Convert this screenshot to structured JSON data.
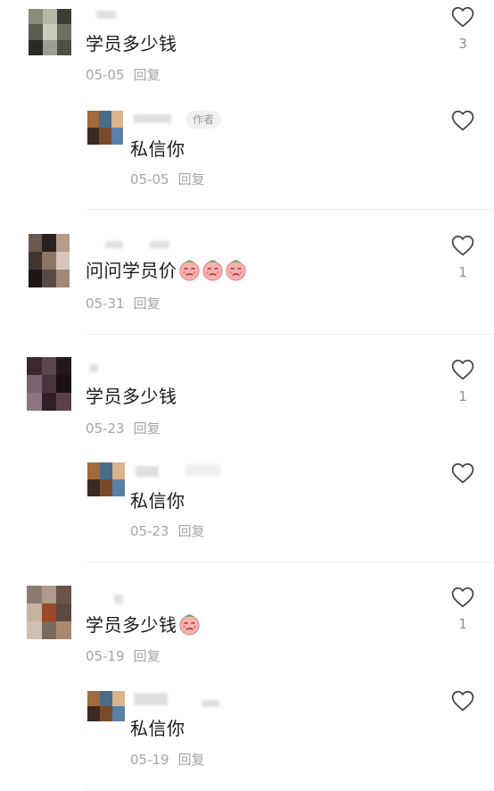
{
  "comments": [
    {
      "text": "学员多少钱",
      "date": "05-05",
      "reply_label": "回复",
      "likes": "3",
      "avatar_colors": [
        "#8a8a7a",
        "#b7b7a6",
        "#3c3c34",
        "#5b5b52",
        "#c9c9bd",
        "#6e6e60",
        "#2a2a25",
        "#9c9c90",
        "#4e4e46"
      ],
      "reply": {
        "text": "私信你",
        "date": "05-05",
        "reply_label": "回复",
        "author_tag": "作者",
        "avatar_colors": [
          "#a06b3c",
          "#4a6b8a",
          "#d9b48c",
          "#3a2a22",
          "#7a4b2a",
          "#5c7fa8"
        ]
      }
    },
    {
      "text": "问问学员价",
      "emoji_count": 3,
      "date": "05-31",
      "reply_label": "回复",
      "likes": "1",
      "avatar_colors": [
        "#6b5a50",
        "#2a2220",
        "#b79c8e",
        "#413530",
        "#8e7566",
        "#d8c6bb",
        "#1c1614",
        "#5a4a42",
        "#a08878"
      ]
    },
    {
      "text": "学员多少钱",
      "date": "05-23",
      "reply_label": "回复",
      "likes": "1",
      "avatar_colors": [
        "#3a2a30",
        "#5c4450",
        "#24181d",
        "#7a6070",
        "#4a3440",
        "#1c1216",
        "#8e7482",
        "#2e2026",
        "#5a4048"
      ],
      "reply": {
        "text": "私信你",
        "date": "05-23",
        "reply_label": "回复",
        "author_tag": "",
        "avatar_colors": [
          "#a06b3c",
          "#4a6b8a",
          "#d9b48c",
          "#3a2a22",
          "#7a4b2a",
          "#5c7fa8"
        ]
      }
    },
    {
      "text": "学员多少钱",
      "emoji_count": 1,
      "date": "05-19",
      "reply_label": "回复",
      "likes": "1",
      "avatar_colors": [
        "#8a7a70",
        "#b09a8c",
        "#6a5448",
        "#c8b2a0",
        "#9a4a2a",
        "#5a4a40",
        "#d0c0b0",
        "#7a6a5c",
        "#a88a70"
      ],
      "reply": {
        "text": "私信你",
        "date": "05-19",
        "reply_label": "回复",
        "author_tag": "",
        "avatar_colors": [
          "#a06b3c",
          "#4a6b8a",
          "#d9b48c",
          "#3a2a22",
          "#7a4b2a",
          "#5c7fa8"
        ]
      }
    }
  ]
}
